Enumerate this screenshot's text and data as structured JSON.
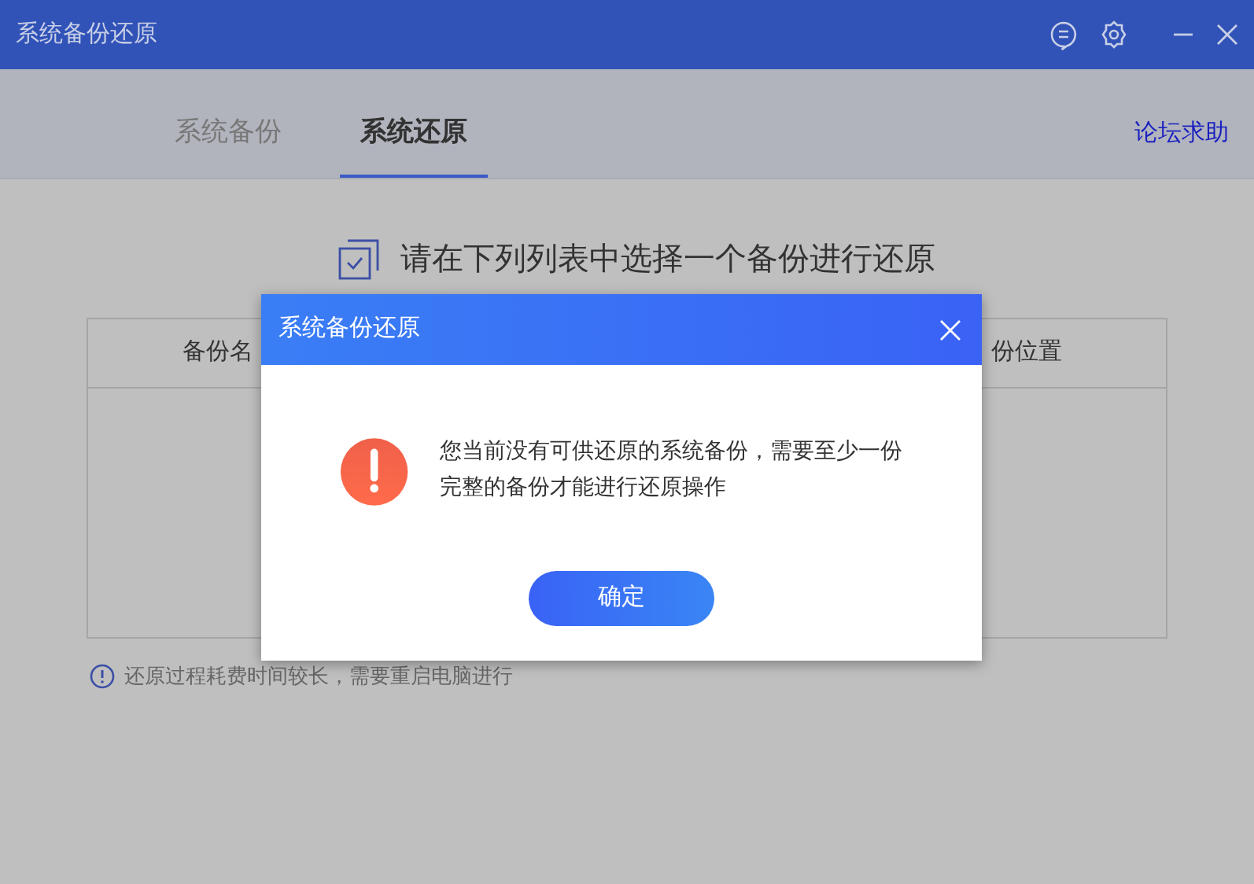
{
  "window": {
    "title": "系统备份还原"
  },
  "tabs": [
    {
      "label": "系统备份",
      "selected": false
    },
    {
      "label": "系统还原",
      "selected": true
    }
  ],
  "forum_link": "论坛求助",
  "heading": "请在下列列表中选择一个备份进行还原",
  "table": {
    "columns": [
      "备份名",
      "份位置"
    ]
  },
  "note": "还原过程耗费时间较长，需要重启电脑进行",
  "dialog": {
    "title": "系统备份还原",
    "message": "您当前没有可供还原的系统备份，需要至少一份完整的备份才能进行还原操作",
    "button": "确定"
  }
}
